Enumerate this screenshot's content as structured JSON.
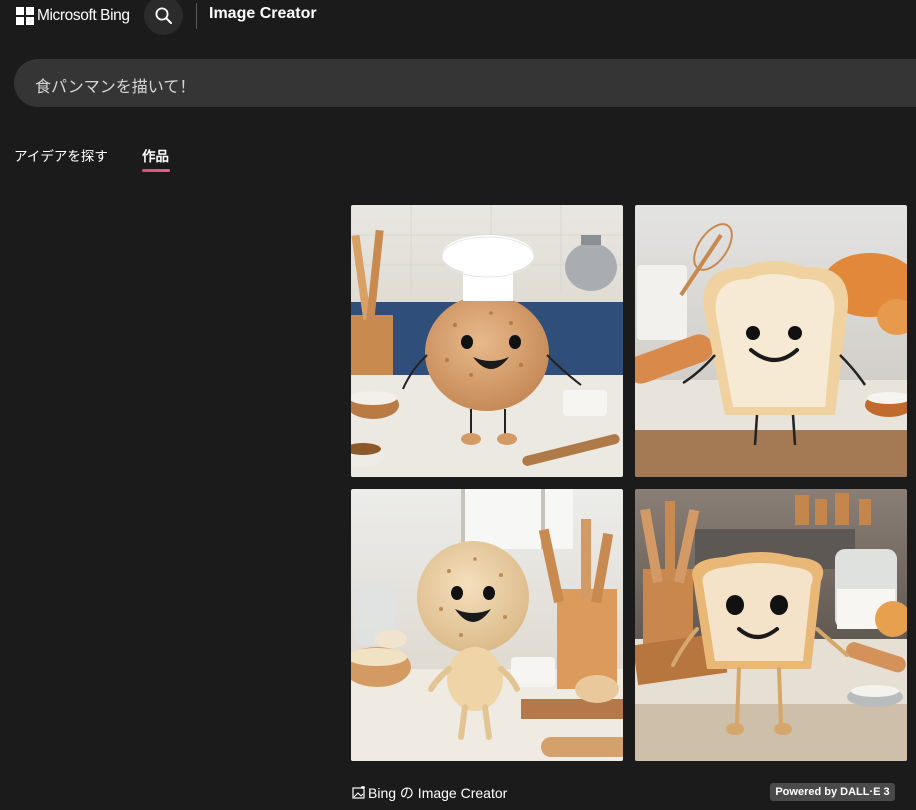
{
  "header": {
    "brand": "Microsoft Bing",
    "app_title": "Image Creator"
  },
  "prompt": {
    "value": "食パンマンを描いて！"
  },
  "tabs": [
    {
      "label": "アイデアを探す",
      "selected": false
    },
    {
      "label": "作品",
      "selected": true
    }
  ],
  "results": {
    "images": [
      {
        "subject": "round bread character wearing chef hat in kitchen"
      },
      {
        "subject": "smiling toast slice character on floured counter"
      },
      {
        "subject": "round dough character standing in kitchen"
      },
      {
        "subject": "toast slice character with arms and legs in kitchen"
      }
    ]
  },
  "footer": {
    "credit": "Bing の Image Creator",
    "badge": "Powered by DALL·E 3"
  },
  "colors": {
    "background": "#1b1b1b",
    "prompt_bg": "#353535",
    "tab_accent": "#e04a6e",
    "badge_bg": "#4a4a4a"
  },
  "icons": [
    "windows-logo-icon",
    "search-icon",
    "image-icon"
  ]
}
